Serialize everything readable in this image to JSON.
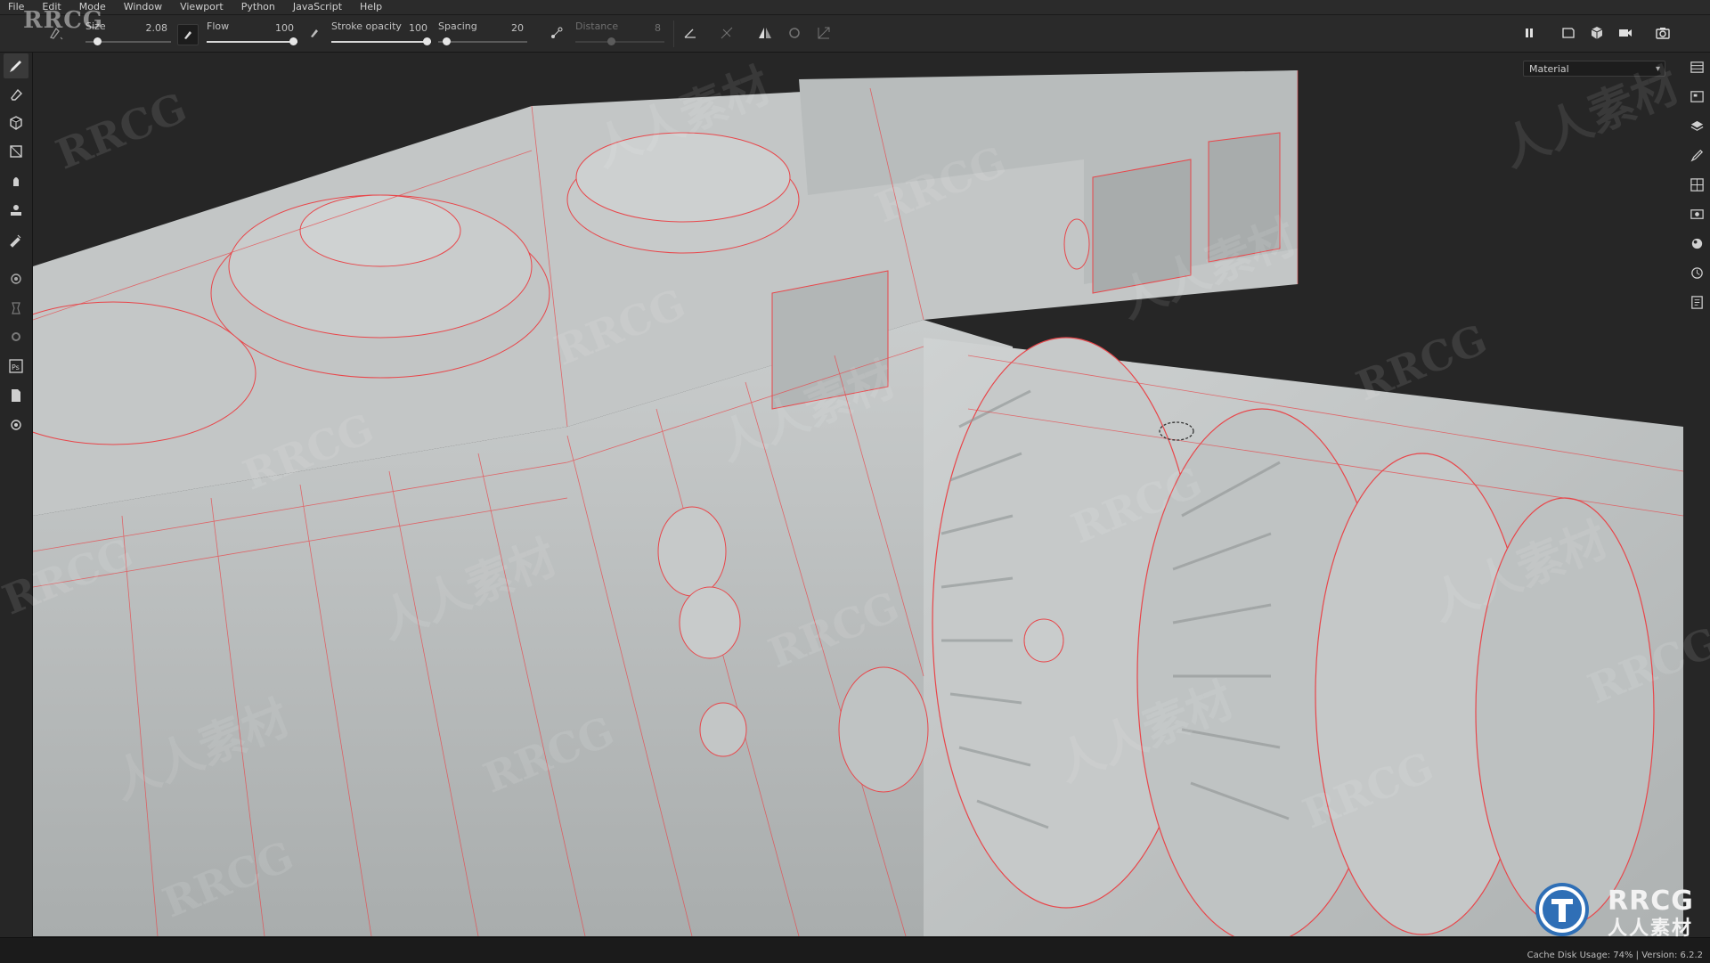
{
  "menubar": {
    "items": [
      "File",
      "Edit",
      "Mode",
      "Window",
      "Viewport",
      "Python",
      "JavaScript",
      "Help"
    ]
  },
  "toolbar": {
    "size": {
      "label": "Size",
      "value": "2.08",
      "fraction": 0.1
    },
    "flow": {
      "label": "Flow",
      "value": "100",
      "fraction": 1.0
    },
    "stroke_opacity": {
      "label": "Stroke opacity",
      "value": "100",
      "fraction": 1.0
    },
    "spacing": {
      "label": "Spacing",
      "value": "20",
      "fraction": 0.05
    },
    "distance": {
      "label": "Distance",
      "value": "8",
      "fraction": 0.4
    },
    "icons": {
      "left": [
        "brush-preset-icon",
        "flow-pressure-icon",
        "opacity-pressure-icon",
        "lazy-mouse-icon"
      ],
      "middle": [
        "angle-icon",
        "jitter-icon",
        "symmetry-icon",
        "follow-path-icon",
        "transform-icon"
      ],
      "right": [
        "pause-icon",
        "2d-view-icon",
        "3d-view-icon",
        "camera-icon",
        "screenshot-icon"
      ]
    }
  },
  "left_tools": [
    "paint-brush-icon",
    "eraser-icon",
    "projection-icon",
    "polygon-fill-icon",
    "smudge-icon",
    "clone-icon",
    "color-picker-icon",
    "bake-icon",
    "geometry-decal-icon",
    "settings-gear-icon",
    "photoshop-icon",
    "export-icon",
    "plugins-icon"
  ],
  "right_tools": [
    "texture-set-list-icon",
    "texture-set-settings-icon",
    "layers-icon",
    "properties-icon",
    "display-settings-icon",
    "viewer-settings-icon",
    "shader-settings-icon",
    "history-icon",
    "log-icon"
  ],
  "viewport": {
    "mode_select": {
      "selected": "Material"
    },
    "wireframe_color": "#e8464a",
    "surface_color": "#bfc2c2"
  },
  "statusbar": {
    "text": "Cache Disk Usage:  74% | Version: 6.2.2"
  },
  "watermarks": {
    "top_left": "RRCG",
    "repeat_latin": "RRCG",
    "repeat_cjk": "人人素材",
    "logo_text_1": "RRCG",
    "logo_text_2": "人人素材"
  }
}
